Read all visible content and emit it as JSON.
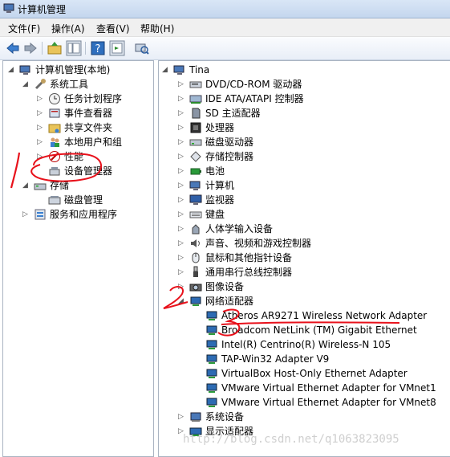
{
  "window": {
    "title": "计算机管理"
  },
  "menu": [
    "文件(F)",
    "操作(A)",
    "查看(V)",
    "帮助(H)"
  ],
  "toolbar": [
    "back-icon",
    "forward-icon",
    "up-folder-icon",
    "show-hide-tree-icon",
    "help-icon",
    "properties-icon",
    "scan-hardware-icon"
  ],
  "left_tree": [
    {
      "label": "计算机管理(本地)",
      "icon": "computer-mgmt-icon",
      "level": 0,
      "expand": "▲"
    },
    {
      "label": "系统工具",
      "icon": "tools-icon",
      "level": 1,
      "expand": "▲"
    },
    {
      "label": "任务计划程序",
      "icon": "clock-icon",
      "level": 2,
      "expand": "▷"
    },
    {
      "label": "事件查看器",
      "icon": "event-viewer-icon",
      "level": 2,
      "expand": "▷"
    },
    {
      "label": "共享文件夹",
      "icon": "shared-folder-icon",
      "level": 2,
      "expand": "▷"
    },
    {
      "label": "本地用户和组",
      "icon": "users-icon",
      "level": 2,
      "expand": "▷"
    },
    {
      "label": "性能",
      "icon": "performance-icon",
      "level": 2,
      "expand": "▷"
    },
    {
      "label": "设备管理器",
      "icon": "device-manager-icon",
      "level": 2,
      "expand": ""
    },
    {
      "label": "存储",
      "icon": "storage-icon",
      "level": 1,
      "expand": "▲"
    },
    {
      "label": "磁盘管理",
      "icon": "disk-mgmt-icon",
      "level": 2,
      "expand": ""
    },
    {
      "label": "服务和应用程序",
      "icon": "services-icon",
      "level": 1,
      "expand": "▷"
    }
  ],
  "right_tree": {
    "root": "Tina",
    "categories": [
      {
        "label": "DVD/CD-ROM 驱动器",
        "icon": "dvd-icon"
      },
      {
        "label": "IDE ATA/ATAPI 控制器",
        "icon": "ide-controller-icon"
      },
      {
        "label": "SD 主适配器",
        "icon": "sd-card-icon"
      },
      {
        "label": "处理器",
        "icon": "processor-icon"
      },
      {
        "label": "磁盘驱动器",
        "icon": "disk-drive-icon"
      },
      {
        "label": "存储控制器",
        "icon": "storage-controller-icon"
      },
      {
        "label": "电池",
        "icon": "battery-icon"
      },
      {
        "label": "计算机",
        "icon": "computer-icon"
      },
      {
        "label": "监视器",
        "icon": "monitor-icon"
      },
      {
        "label": "键盘",
        "icon": "keyboard-icon"
      },
      {
        "label": "人体学输入设备",
        "icon": "hid-icon"
      },
      {
        "label": "声音、视频和游戏控制器",
        "icon": "sound-icon"
      },
      {
        "label": "鼠标和其他指针设备",
        "icon": "mouse-icon"
      },
      {
        "label": "通用串行总线控制器",
        "icon": "usb-icon"
      },
      {
        "label": "图像设备",
        "icon": "camera-icon"
      }
    ],
    "network": {
      "label": "网络适配器",
      "icon": "network-adapter-icon",
      "adapters": [
        "Atheros AR9271 Wireless Network Adapter",
        "Broadcom NetLink (TM) Gigabit Ethernet",
        "Intel(R) Centrino(R) Wireless-N 105",
        "TAP-Win32 Adapter V9",
        "VirtualBox Host-Only Ethernet Adapter",
        "VMware Virtual Ethernet Adapter for VMnet1",
        "VMware Virtual Ethernet Adapter for VMnet8"
      ]
    },
    "after": [
      {
        "label": "系统设备",
        "icon": "system-device-icon"
      },
      {
        "label": "显示适配器",
        "icon": "display-adapter-icon"
      }
    ]
  },
  "annotations": [
    "1",
    "2",
    "3"
  ],
  "watermark": "http://blog.csdn.net/q1063823095",
  "colors": {
    "annotation_red": "#e8111b",
    "title_bg": "#c4d6ee",
    "adapter_icon": "#2d6bb3"
  }
}
